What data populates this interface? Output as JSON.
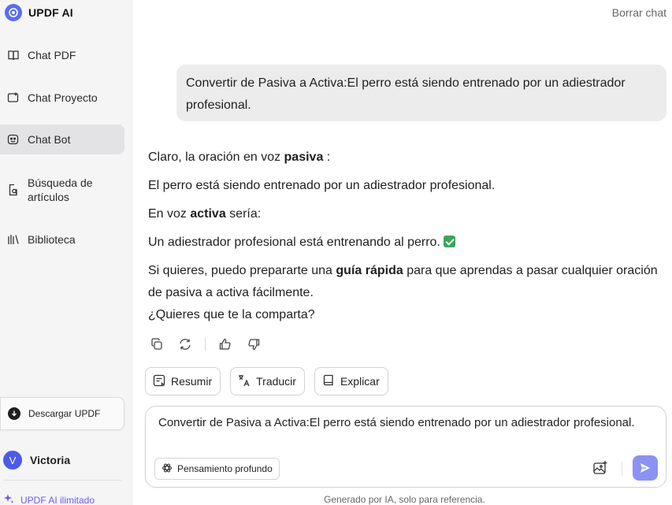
{
  "brand": {
    "name": "UPDF AI",
    "icon": "updf-logo-icon",
    "accent": "#5a6df0"
  },
  "sidebar": {
    "items": [
      {
        "label": "Chat PDF",
        "icon": "book-open-icon",
        "active": false
      },
      {
        "label": "Chat Proyecto",
        "icon": "folder-plus-icon",
        "active": false
      },
      {
        "label": "Chat Bot",
        "icon": "bot-icon",
        "active": true
      },
      {
        "label": "Búsqueda de\nartículos",
        "icon": "doc-search-icon",
        "active": false
      },
      {
        "label": "Biblioteca",
        "icon": "library-icon",
        "active": false
      }
    ],
    "download_label": "Descargar UPDF",
    "user": {
      "initial": "V",
      "name": "Victoria",
      "avatar_color": "#4b5be8"
    },
    "unlimited_label": "UPDF AI ilimitado"
  },
  "header": {
    "clear_label": "Borrar chat"
  },
  "conversation": {
    "user_message": "Convertir de Pasiva a Activa:El perro está siendo entrenado por un adiestrador profesional.",
    "answer": {
      "line1_pre": "Claro, la oración en voz ",
      "line1_bold": "pasiva",
      "line1_post": " :",
      "line2": "El perro está siendo entrenado por un adiestrador profesional.",
      "line3_pre": "En voz ",
      "line3_bold": "activa",
      "line3_post": " sería:",
      "line4": "Un adiestrador profesional está entrenando al perro. ",
      "line5_pre": "Si quieres, puedo prepararte una ",
      "line5_bold": "guía rápida",
      "line5_post": " para que aprendas a pasar cualquier oración de pasiva a activa fácilmente.",
      "line6": "¿Quieres que te la comparta?"
    }
  },
  "actions": [
    "copy-icon",
    "regenerate-icon",
    "thumbs-up-icon",
    "thumbs-down-icon"
  ],
  "chips": [
    {
      "label": "Resumir",
      "icon": "summary-icon"
    },
    {
      "label": "Traducir",
      "icon": "translate-icon"
    },
    {
      "label": "Explicar",
      "icon": "book-icon"
    }
  ],
  "composer": {
    "value": "Convertir de Pasiva a Activa:El perro está siendo entrenado por un adiestrador profesional.",
    "deep_thinking_label": "Pensamiento profundo",
    "send_color": "#8c92f2"
  },
  "footnote": "Generado por IA, solo para referencia."
}
